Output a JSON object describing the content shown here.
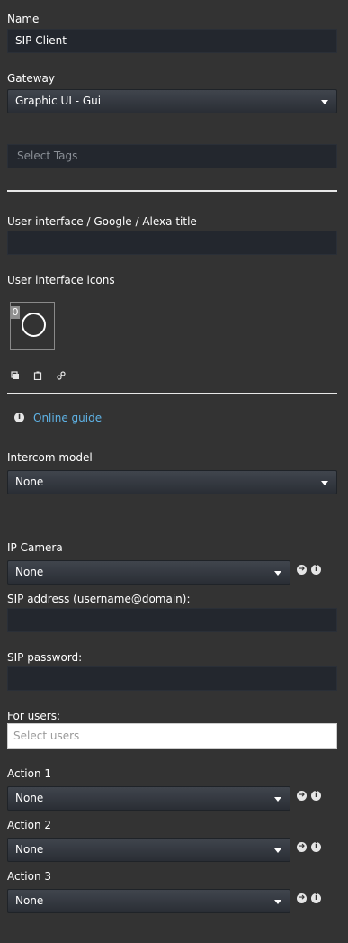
{
  "name": {
    "label": "Name",
    "value": "SIP Client"
  },
  "gateway": {
    "label": "Gateway",
    "value": "Graphic UI - Gui"
  },
  "tags": {
    "placeholder": "Select Tags"
  },
  "ui_title": {
    "label": "User interface / Google / Alexa title",
    "value": ""
  },
  "ui_icons": {
    "label": "User interface icons",
    "badge": "0"
  },
  "online_guide": {
    "link": "Online guide"
  },
  "intercom": {
    "label": "Intercom model",
    "value": "None"
  },
  "ip_camera": {
    "label": "IP Camera",
    "value": "None"
  },
  "sip_address": {
    "label": "SIP address (username@domain):",
    "value": ""
  },
  "sip_password": {
    "label": "SIP password:",
    "value": ""
  },
  "users": {
    "label": "For users:",
    "placeholder": "Select users"
  },
  "actions": [
    {
      "label": "Action 1",
      "value": "None"
    },
    {
      "label": "Action 2",
      "value": "None"
    },
    {
      "label": "Action 3",
      "value": "None"
    }
  ],
  "colors": {
    "background": "#333333",
    "input": "#23272e",
    "link": "#5fb3e6",
    "divider": "#e8e8e8"
  },
  "icons": [
    "copy-icon",
    "paste-icon",
    "link-icon",
    "info-icon",
    "arrow-right-icon"
  ]
}
